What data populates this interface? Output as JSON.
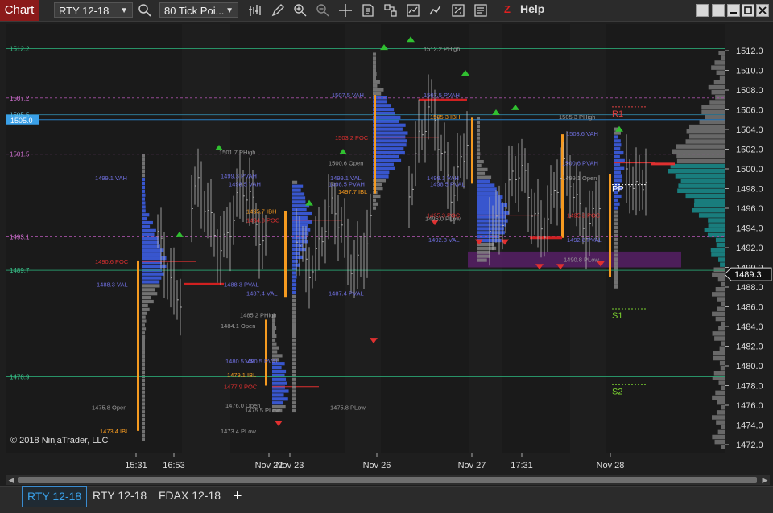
{
  "toolbar": {
    "chart_label": "Chart",
    "instrument": "RTY 12-18",
    "interval": "80 Tick Poi...",
    "help_label": "Help",
    "z_label": "Z"
  },
  "price_axis": {
    "ticks": [
      "1512.0",
      "1510.0",
      "1508.0",
      "1506.0",
      "1504.0",
      "1502.0",
      "1500.0",
      "1498.0",
      "1496.0",
      "1494.0",
      "1492.0",
      "1490.0",
      "1488.0",
      "1486.0",
      "1484.0",
      "1482.0",
      "1480.0",
      "1478.0",
      "1476.0",
      "1474.0",
      "1472.0"
    ],
    "last_price": "1489.3"
  },
  "time_axis": {
    "labels": [
      "15:31",
      "16:53",
      "Nov 22",
      "Nov 23",
      "Nov 26",
      "Nov 27",
      "17:31",
      "Nov 28"
    ]
  },
  "left_levels": [
    "1512.2",
    "1507.2",
    "1505.5",
    "1505.0",
    "1501.5",
    "1493.1",
    "1489.7",
    "1478.9"
  ],
  "annotations": {
    "pivots": [
      "R1",
      "PP",
      "S1",
      "S2"
    ],
    "session1": [
      "1499.1 VAH",
      "1490.6 POC",
      "1488.3 VAL",
      "1475.8 Open",
      "1473.4 IBL"
    ],
    "session2": [
      "1501.7 PHigh",
      "1499.3 PVAH",
      "1498.5 VAH",
      "1488.3 PVAL",
      "1487.4 VAL",
      "1485.2 PHigh",
      "1484.1 Open",
      "1480.5 VAL",
      "1480.5 PVAL",
      "1479.1 IBL",
      "1477.9 POC",
      "1476.0 Open",
      "1475.5 PLow",
      "1473.4 PLow"
    ],
    "session3": [
      "1495.7 IBH",
      "1494.8 POC",
      "1487.4 PVAL",
      "1475.8 PLow"
    ],
    "session4": [
      "1507.5 VAH",
      "1503.2 POC",
      "1500.6 Open",
      "1499.1 VAL",
      "1498.5 PVAH",
      "1497.7 IBL"
    ],
    "session5": [
      "1512.2 PHigh",
      "1507.5 PVAH",
      "1505.3 IBH",
      "1499.1 VAH",
      "1498.5 PVAL",
      "1495.3 POC",
      "1495.0 PLow",
      "1492.8 VAL"
    ],
    "session6": [
      "1505.3 PHigh",
      "1503.6 VAH",
      "1500.6 PVAH",
      "1499.1 Open",
      "1495.3 POC",
      "1492.8 PVAL",
      "1490.8 PLow"
    ]
  },
  "copyright": "© 2018 NinjaTrader, LLC",
  "tabs": [
    "RTY 12-18",
    "RTY 12-18",
    "FDAX 12-18"
  ],
  "colors": {
    "accent": "#3aa0e8",
    "poc": "#e03030",
    "vah": "#5a5ad0",
    "ib": "#f59a20",
    "green": "#30b030",
    "red": "#e03030"
  }
}
